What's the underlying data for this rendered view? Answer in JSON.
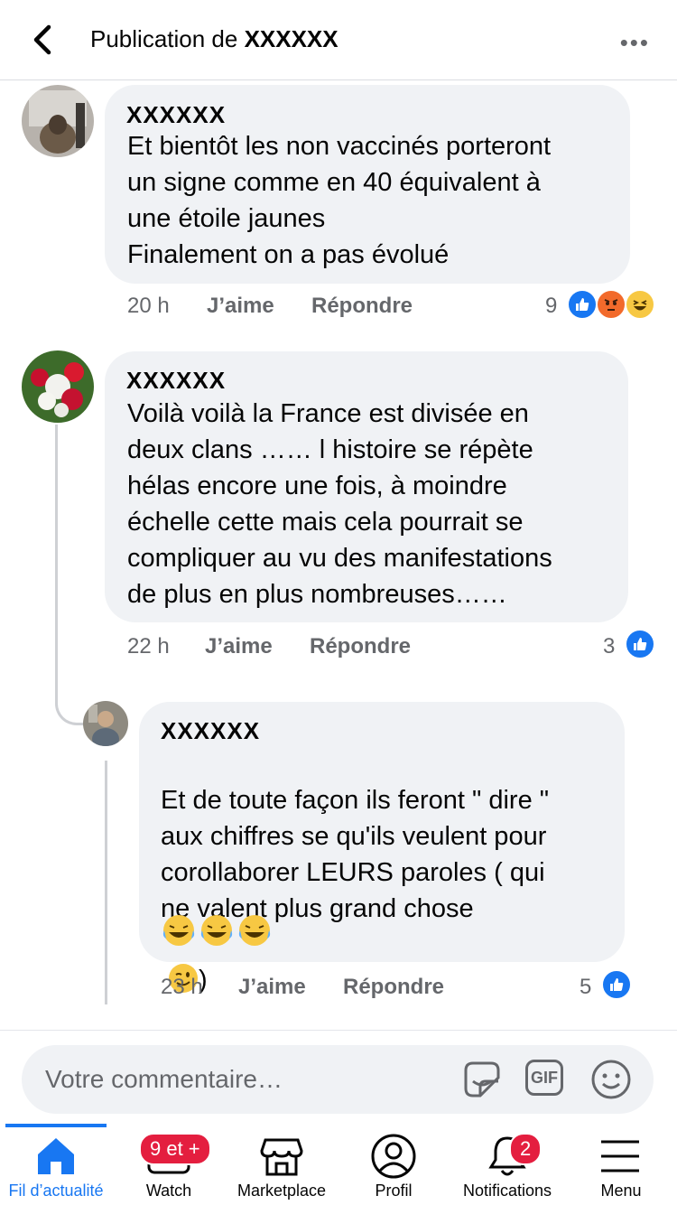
{
  "header": {
    "title_prefix": "Publication de ",
    "title_name": "XXXXXX"
  },
  "comments": [
    {
      "author": "XXXXXX",
      "text": "Et bientôt les non vaccinés porteront\nun signe comme en 40 équivalent à\nune étoile jaunes\nFinalement on a pas évolué",
      "time": "20 h",
      "like": "J’aime",
      "reply": "Répondre",
      "reactions": "9"
    },
    {
      "author": "XXXXXX",
      "text": "Voilà voilà la France est divisée en\ndeux clans …… l histoire se répète\nhélas encore une fois, à moindre\néchelle cette mais cela pourrait se\ncompliquer au vu des manifestations\nde plus en plus nombreuses……",
      "time": "22 h",
      "like": "J’aime",
      "reply": "Répondre",
      "reactions": "3"
    },
    {
      "author": "XXXXXX",
      "text": "Et de toute façon ils feront \" dire \"\naux chiffres se qu'ils veulent pour\ncorollaborer LEURS paroles  ( qui\nne valent plus grand chose",
      "text_end": ")",
      "time": "23 h",
      "like": "J’aime",
      "reply": "Répondre",
      "reactions": "5"
    }
  ],
  "composer": {
    "placeholder": "Votre commentaire…"
  },
  "nav": {
    "items": [
      {
        "label": "Fil d’actualité",
        "icon": "home-icon"
      },
      {
        "label": "Watch",
        "icon": "watch-icon",
        "badge": "9 et +"
      },
      {
        "label": "Marketplace",
        "icon": "marketplace-icon"
      },
      {
        "label": "Profil",
        "icon": "profile-icon"
      },
      {
        "label": "Notifications",
        "icon": "bell-icon",
        "badge": "2"
      },
      {
        "label": "Menu",
        "icon": "menu-icon"
      }
    ]
  },
  "colors": {
    "accent": "#1877f2",
    "bubble": "#f0f2f5",
    "badge": "#e41e3f"
  }
}
